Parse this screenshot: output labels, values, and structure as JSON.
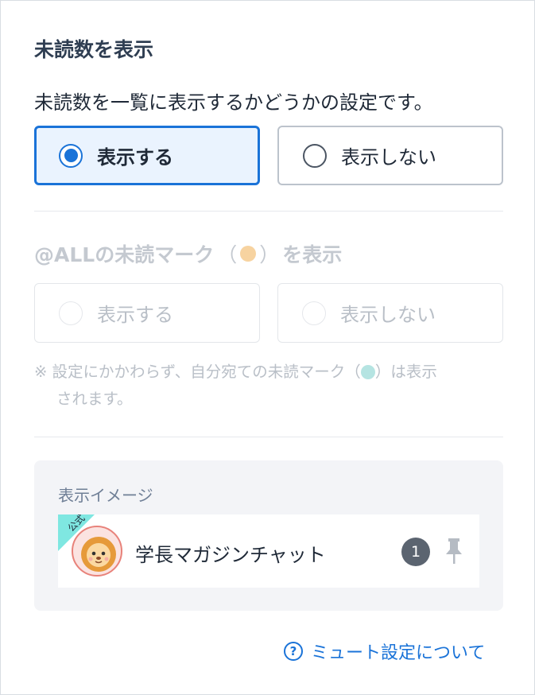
{
  "unread_count": {
    "title": "未読数を表示",
    "description": "未読数を一覧に表示するかどうかの設定です。",
    "options": [
      {
        "label": "表示する",
        "selected": true
      },
      {
        "label": "表示しない",
        "selected": false
      }
    ]
  },
  "all_mark": {
    "title_main": "@ALLの未読マーク",
    "paren_open": "（",
    "paren_close": "）",
    "title_suffix": "を表示",
    "disabled": true,
    "options": [
      {
        "label": "表示する",
        "selected": false
      },
      {
        "label": "表示しない",
        "selected": false
      }
    ],
    "note_prefix": "※ 設定にかかわらず、自分宛ての未読マーク",
    "note_paren_open": "（",
    "note_paren_close": "）",
    "note_suffix": "は表示",
    "note_line2": "されます。"
  },
  "preview": {
    "label": "表示イメージ",
    "ribbon_text": "公式",
    "chat_name": "学長マガジンチャット",
    "unread_count": "1"
  },
  "help": {
    "icon_text": "?",
    "label": "ミュート設定について"
  },
  "colors": {
    "accent": "#1a73d8",
    "all_mark_dot": "#f7d3a0",
    "self_mark_dot": "#b5e4e2",
    "ribbon": "#7fe7e1"
  }
}
